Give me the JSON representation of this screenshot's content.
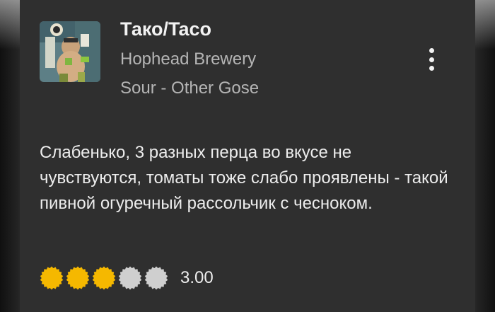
{
  "checkin": {
    "beer_name": "Тако/Taco",
    "brewery": "Hophead Brewery",
    "style": "Sour - Other Gose",
    "comment": "Слабенько, 3 разных перца во вкусе не чувствуются, томаты тоже слабо проявлены - такой пивной огуречный рассольчик с чесноком.",
    "rating": {
      "score_text": "3.00",
      "value": 3,
      "max": 5,
      "filled_color": "#f5b800",
      "empty_color": "#cfcfcf"
    },
    "menu_icon": "more-vertical-icon",
    "rating_icon": "bottle-cap-icon"
  }
}
